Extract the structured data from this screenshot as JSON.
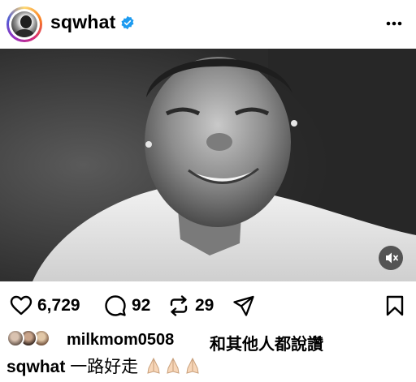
{
  "post": {
    "username": "sqwhat",
    "verified": true,
    "icons": {
      "more": "more-options-icon",
      "verified": "verified-badge-icon",
      "mute": "mute-icon"
    },
    "media": {
      "type": "video",
      "muted": true
    }
  },
  "actions": {
    "likes_count": "6,729",
    "comments_count": "92",
    "reposts_count": "29",
    "icons": [
      "heart-icon",
      "comment-icon",
      "repost-icon",
      "share-icon",
      "save-icon"
    ]
  },
  "likes": {
    "user": "milkmom0508",
    "text": "和其他人都說讚"
  },
  "caption": {
    "username": "sqwhat",
    "text": "一路好走"
  },
  "colors": {
    "verified": "#1d9bf0",
    "ring_start": "#feda75",
    "ring_end": "#962fbf"
  }
}
